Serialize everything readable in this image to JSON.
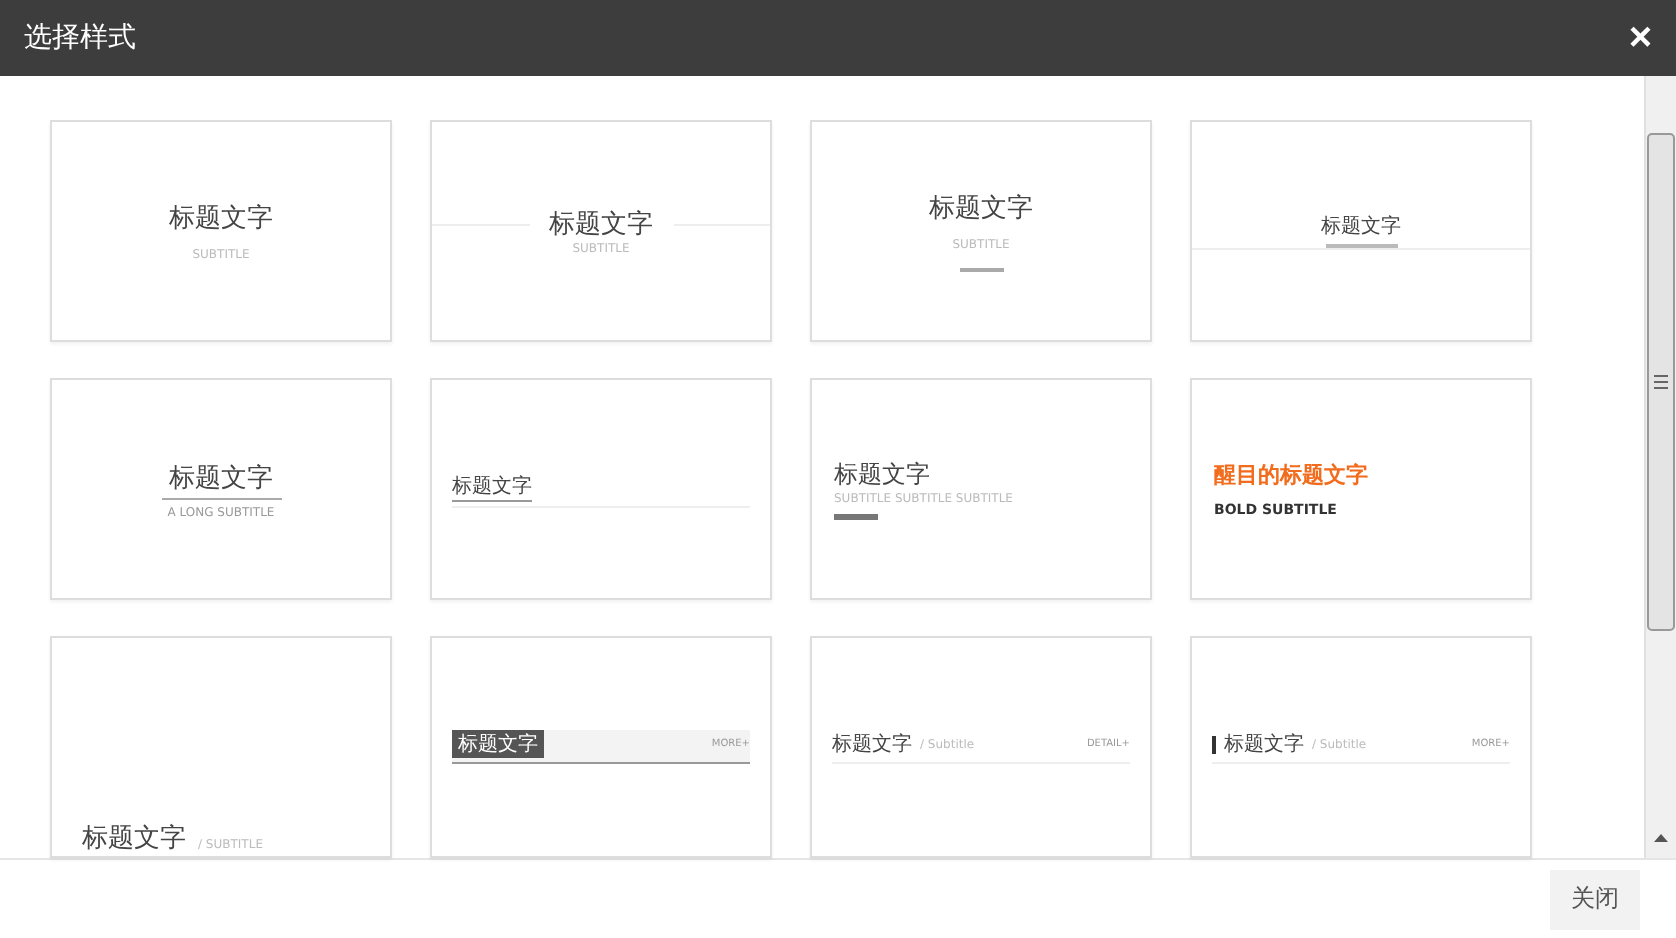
{
  "window": {
    "title": "选择样式",
    "close": "×"
  },
  "styles": [
    {
      "kind": "center",
      "title": "标题文字",
      "subtitle": "SUBTITLE"
    },
    {
      "kind": "center-lines",
      "title": "标题文字",
      "subtitle": "SUBTITLE"
    },
    {
      "kind": "center-bar",
      "title": "标题文字",
      "subtitle": "SUBTITLE"
    },
    {
      "kind": "band",
      "title": "标题文字"
    },
    {
      "kind": "underline",
      "title": "标题文字",
      "subtitle": "A LONG SUBTITLE"
    },
    {
      "kind": "tiny-line",
      "title": "标题文字"
    },
    {
      "kind": "left-bar",
      "title": "标题文字",
      "subtitle": "SUBTITLE SUBTITLE SUBTITLE"
    },
    {
      "kind": "bold",
      "title": "醒目的标题文字",
      "subtitle": "BOLD SUBTITLE"
    },
    {
      "kind": "slash",
      "title": "标题文字",
      "subtitle": "/ SUBTITLE"
    },
    {
      "kind": "label-block",
      "title": "标题文字",
      "more": "MORE+"
    },
    {
      "kind": "detail-line",
      "title": "标题文字",
      "subtitle": "/ Subtitle",
      "more": "DETAIL+"
    },
    {
      "kind": "marker-line",
      "title": "标题文字",
      "subtitle": "/ Subtitle",
      "more": "MORE+"
    }
  ],
  "footer": {
    "close_button": "关闭"
  }
}
